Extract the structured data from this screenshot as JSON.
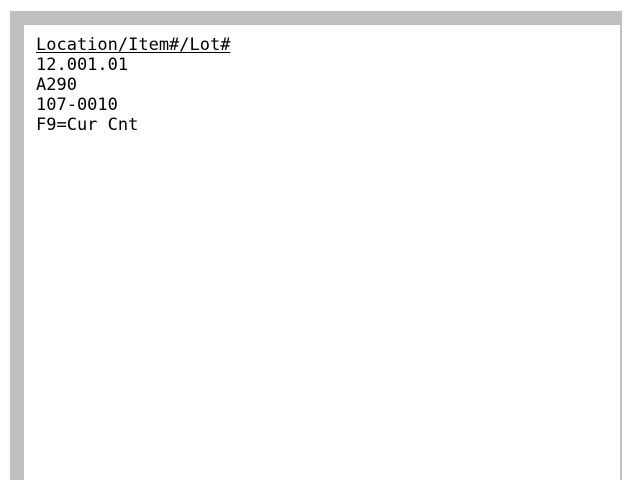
{
  "screen": {
    "header": "Location/Item#/Lot#",
    "location": "12.001.01",
    "item": "A290",
    "lot": "107-0010",
    "function_key_hint": "F9=Cur Cnt"
  }
}
